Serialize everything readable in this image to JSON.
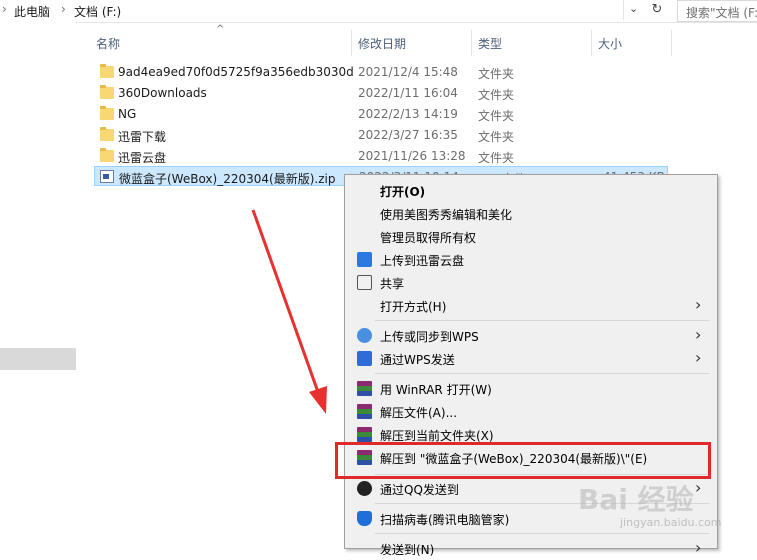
{
  "address": {
    "crumbs": [
      "此电脑",
      "文档 (F:)"
    ],
    "search_placeholder": "搜索\"文档 (F:"
  },
  "columns": {
    "name": "名称",
    "date": "修改日期",
    "type": "类型",
    "size": "大小"
  },
  "files": [
    {
      "name": "9ad4ea9ed70f0d5725f9a356edb3030d",
      "date": "2021/12/4 15:48",
      "type": "文件夹",
      "size": ""
    },
    {
      "name": "360Downloads",
      "date": "2022/1/11 16:04",
      "type": "文件夹",
      "size": ""
    },
    {
      "name": "NG",
      "date": "2022/2/13 14:19",
      "type": "文件夹",
      "size": ""
    },
    {
      "name": "迅雷下载",
      "date": "2022/3/27 16:35",
      "type": "文件夹",
      "size": ""
    },
    {
      "name": "迅雷云盘",
      "date": "2021/11/26 13:28",
      "type": "文件夹",
      "size": ""
    },
    {
      "name": "微蓝盒子(WeBox)_220304(最新版).zip",
      "date": "2022/3/11 10:14",
      "type": "ZIP 文件",
      "size": "41,453 KB"
    }
  ],
  "context_menu": {
    "items": [
      {
        "label": "打开(O)",
        "icon": "none",
        "bold": true
      },
      {
        "label": "使用美图秀秀编辑和美化",
        "icon": "none"
      },
      {
        "label": "管理员取得所有权",
        "icon": "none"
      },
      {
        "label": "上传到迅雷云盘",
        "icon": "xunlei-icon"
      },
      {
        "label": "共享",
        "icon": "share-icon"
      },
      {
        "label": "打开方式(H)",
        "icon": "none",
        "submenu": true
      },
      {
        "label": "上传或同步到WPS",
        "icon": "wps-cloud-icon",
        "submenu": true
      },
      {
        "label": "通过WPS发送",
        "icon": "wps-send-icon",
        "submenu": true
      },
      {
        "label": "用 WinRAR 打开(W)",
        "icon": "winrar-icon"
      },
      {
        "label": "解压文件(A)...",
        "icon": "winrar-icon"
      },
      {
        "label": "解压到当前文件夹(X)",
        "icon": "winrar-icon"
      },
      {
        "label": "解压到 \"微蓝盒子(WeBox)_220304(最新版)\\\"(E)",
        "icon": "winrar-icon"
      },
      {
        "label": "通过QQ发送到",
        "icon": "qq-icon",
        "submenu": true
      },
      {
        "label": "扫描病毒(腾讯电脑管家)",
        "icon": "shield-icon"
      },
      {
        "label": "发送到(N)",
        "icon": "none",
        "submenu": true
      }
    ]
  },
  "watermark": {
    "main": "Bai 经验",
    "sub": "jingyan.baidu.com"
  },
  "colors": {
    "selection": "#cce8ff",
    "highlight_box": "#e02a2a",
    "arrow": "#e8312f"
  }
}
